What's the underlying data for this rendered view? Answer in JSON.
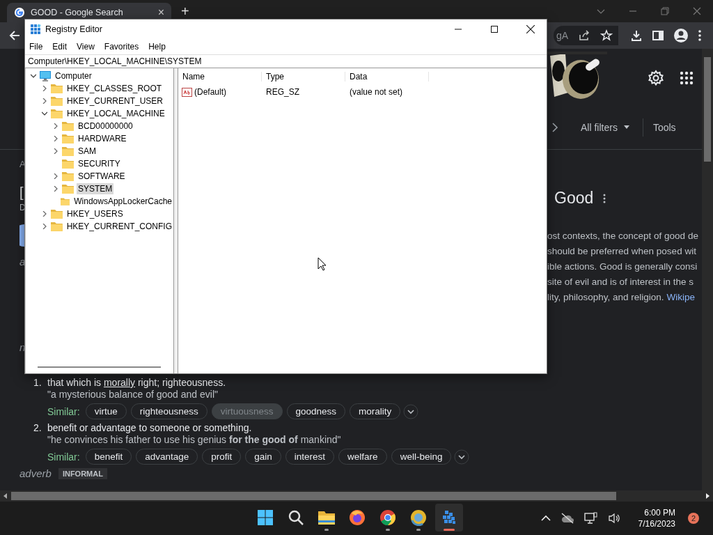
{
  "browser": {
    "tab": {
      "title": "GOOD - Google Search",
      "close": "×"
    },
    "new_tab": "+",
    "address_fragment": "gA"
  },
  "results_header": {
    "all_filters": "All filters",
    "tools": "Tools"
  },
  "left_fragments": [
    {
      "kind": "label",
      "text": "A"
    },
    {
      "kind": "title",
      "text": "["
    },
    {
      "kind": "small",
      "text": "D"
    },
    {
      "kind": "avatar"
    },
    {
      "kind": "italic",
      "text": "a"
    },
    {
      "kind": "italic",
      "text": "n"
    }
  ],
  "knowledge_panel": {
    "title": "Good",
    "lines": [
      "ost contexts, the concept of good de",
      "should be preferred when posed wit",
      "ible actions. Good is generally consi",
      "site of evil and is of interest in the s",
      "lity, philosophy, and religion."
    ],
    "link": "Wikipe"
  },
  "definitions": [
    {
      "number": "1.",
      "text_before": "that which is ",
      "link": "morally",
      "text_after": " right; righteousness.",
      "example": "\"a mysterious balance of good and evil\"",
      "similar_label": "Similar:",
      "similar": [
        {
          "label": "virtue",
          "highlighted": false
        },
        {
          "label": "righteousness",
          "highlighted": false
        },
        {
          "label": "virtuousness",
          "highlighted": true
        },
        {
          "label": "goodness",
          "highlighted": false
        },
        {
          "label": "morality",
          "highlighted": false
        }
      ]
    },
    {
      "number": "2.",
      "text_before": "benefit or advantage to someone or something.",
      "example": "\"he convinces his father to use his genius **for the good of** mankind\"",
      "similar_label": "Similar:",
      "similar": [
        {
          "label": "benefit",
          "highlighted": false
        },
        {
          "label": "advantage",
          "highlighted": false
        },
        {
          "label": "profit",
          "highlighted": false
        },
        {
          "label": "gain",
          "highlighted": false
        },
        {
          "label": "interest",
          "highlighted": false
        },
        {
          "label": "welfare",
          "highlighted": false
        },
        {
          "label": "well-being",
          "highlighted": false
        }
      ]
    }
  ],
  "part_of_speech": {
    "label": "adverb",
    "badge": "INFORMAL"
  },
  "registry": {
    "title": "Registry Editor",
    "menu": [
      "File",
      "Edit",
      "View",
      "Favorites",
      "Help"
    ],
    "address": "Computer\\HKEY_LOCAL_MACHINE\\SYSTEM",
    "tree": [
      {
        "label": "Computer",
        "kind": "computer",
        "expandable": true,
        "expanded": true,
        "selected": false,
        "children": [
          {
            "label": "HKEY_CLASSES_ROOT",
            "kind": "folder",
            "expandable": true,
            "expanded": false,
            "selected": false
          },
          {
            "label": "HKEY_CURRENT_USER",
            "kind": "folder",
            "expandable": true,
            "expanded": false,
            "selected": false
          },
          {
            "label": "HKEY_LOCAL_MACHINE",
            "kind": "folder",
            "expandable": true,
            "expanded": true,
            "selected": false,
            "children": [
              {
                "label": "BCD00000000",
                "kind": "folder",
                "expandable": true,
                "expanded": false,
                "selected": false
              },
              {
                "label": "HARDWARE",
                "kind": "folder",
                "expandable": true,
                "expanded": false,
                "selected": false
              },
              {
                "label": "SAM",
                "kind": "folder",
                "expandable": true,
                "expanded": false,
                "selected": false
              },
              {
                "label": "SECURITY",
                "kind": "folder",
                "expandable": false,
                "selected": false
              },
              {
                "label": "SOFTWARE",
                "kind": "folder",
                "expandable": true,
                "expanded": false,
                "selected": false
              },
              {
                "label": "SYSTEM",
                "kind": "folder",
                "expandable": true,
                "expanded": false,
                "selected": true
              },
              {
                "label": "WindowsAppLockerCache",
                "kind": "folder",
                "expandable": false,
                "selected": false
              }
            ]
          },
          {
            "label": "HKEY_USERS",
            "kind": "folder",
            "expandable": true,
            "expanded": false,
            "selected": false
          },
          {
            "label": "HKEY_CURRENT_CONFIG",
            "kind": "folder",
            "expandable": true,
            "expanded": false,
            "selected": false
          }
        ]
      }
    ],
    "columns": [
      "Name",
      "Type",
      "Data"
    ],
    "rows": [
      {
        "name": "(Default)",
        "type": "REG_SZ",
        "data": "(value not set)"
      }
    ]
  },
  "taskbar": {
    "apps": [
      {
        "kind": "start",
        "running": false,
        "active": false
      },
      {
        "kind": "search",
        "running": false,
        "active": false
      },
      {
        "kind": "explorer",
        "running": true,
        "active": false
      },
      {
        "kind": "firefox",
        "running": false,
        "active": false
      },
      {
        "kind": "chrome",
        "running": true,
        "active": false
      },
      {
        "kind": "chrome-canary",
        "running": true,
        "active": false
      },
      {
        "kind": "registry",
        "running": true,
        "active": true
      }
    ],
    "time": "6:00 PM",
    "date": "7/16/2023",
    "notifications": "2"
  }
}
